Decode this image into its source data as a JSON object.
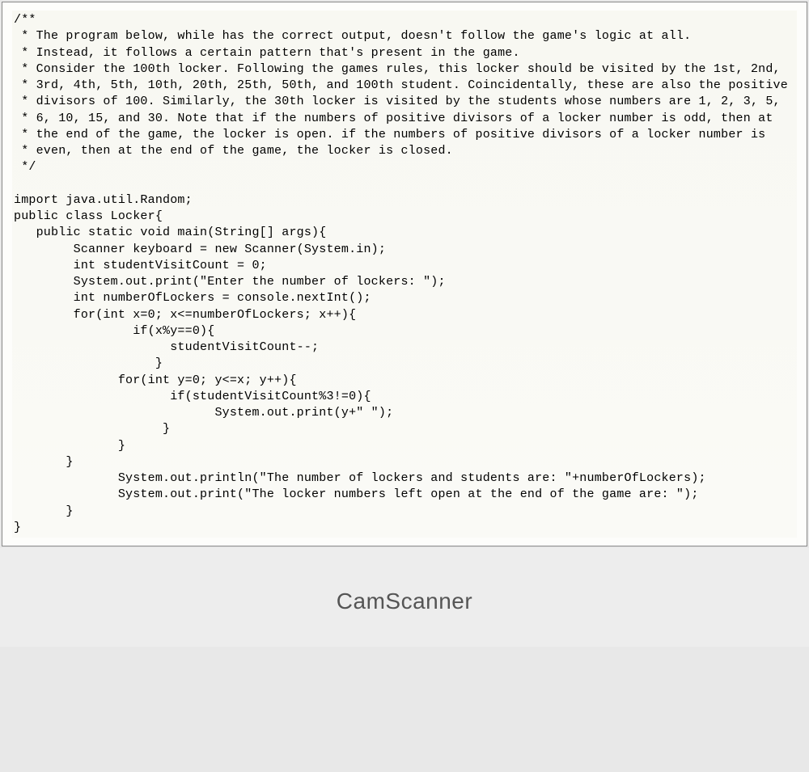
{
  "code_lines": [
    "/**",
    " * The program below, while has the correct output, doesn't follow the game's logic at all.",
    " * Instead, it follows a certain pattern that's present in the game.",
    " * Consider the 100th locker. Following the games rules, this locker should be visited by the 1st, 2nd,",
    " * 3rd, 4th, 5th, 10th, 20th, 25th, 50th, and 100th student. Coincidentally, these are also the positive",
    " * divisors of 100. Similarly, the 30th locker is visited by the students whose numbers are 1, 2, 3, 5,",
    " * 6, 10, 15, and 30. Note that if the numbers of positive divisors of a locker number is odd, then at",
    " * the end of the game, the locker is open. if the numbers of positive divisors of a locker number is",
    " * even, then at the end of the game, the locker is closed.",
    " */",
    "",
    "import java.util.Random;",
    "public class Locker{",
    "   public static void main(String[] args){",
    "        Scanner keyboard = new Scanner(System.in);",
    "        int studentVisitCount = 0;",
    "        System.out.print(\"Enter the number of lockers: \");",
    "        int numberOfLockers = console.nextInt();",
    "        for(int x=0; x<=numberOfLockers; x++){",
    "                if(x%y==0){",
    "                     studentVisitCount--;",
    "                   }",
    "              for(int y=0; y<=x; y++){",
    "                     if(studentVisitCount%3!=0){",
    "                           System.out.print(y+\" \");",
    "                    }",
    "              }",
    "       }",
    "              System.out.println(\"The number of lockers and students are: \"+numberOfLockers);",
    "              System.out.print(\"The locker numbers left open at the end of the game are: \");",
    "       }",
    "}"
  ],
  "watermark": "CamScanner"
}
